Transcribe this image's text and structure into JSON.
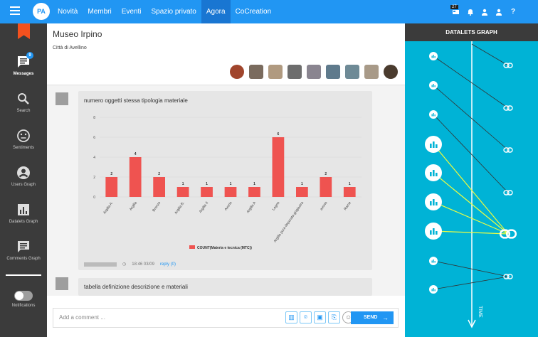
{
  "header": {
    "menu_icon": "menu-icon",
    "logo_text": "PA",
    "nav": [
      "Novità",
      "Membri",
      "Eventi",
      "Spazio privato",
      "Agora",
      "CoCreation"
    ],
    "active_nav": "Agora",
    "notif_count": "27",
    "icons": [
      "language-icon",
      "bell-icon",
      "person-icon",
      "person-icon",
      "help-icon"
    ]
  },
  "sidebar": {
    "items": [
      {
        "label": "Messages",
        "icon": "messages-icon",
        "badge": "9"
      },
      {
        "label": "Search",
        "icon": "search-icon"
      },
      {
        "label": "Sentiments",
        "icon": "sentiment-icon"
      },
      {
        "label": "Users Graph",
        "icon": "users-graph-icon"
      },
      {
        "label": "Datalets Graph",
        "icon": "datalets-graph-icon"
      },
      {
        "label": "Comments Graph",
        "icon": "comments-graph-icon"
      },
      {
        "label": "Notifications",
        "icon": "toggle-icon"
      }
    ]
  },
  "room": {
    "title": "Museo Irpino",
    "subtitle": "Città di Avellino"
  },
  "posts": [
    {
      "title": "numero oggetti stessa tipologia materiale",
      "time": "18:46 03/09",
      "reply": "reply (0)"
    },
    {
      "title": "tabella definizione descrizione e materiali"
    }
  ],
  "chart_data": {
    "type": "bar",
    "categories": [
      "Argilla A.",
      "Argilla",
      "Bronzo",
      "Argilla B.",
      "Argilla II",
      "Avorio",
      "Argilla A",
      "Legno",
      "Argilla pura depurata-grigiastra",
      "avorio",
      "Rame"
    ],
    "values": [
      2,
      4,
      2,
      1,
      1,
      1,
      1,
      6,
      1,
      2,
      1
    ],
    "ylim": [
      0,
      8
    ],
    "yticks": [
      0,
      2,
      4,
      6,
      8
    ],
    "legend": "COUNT(Materia e tecnica (MTC))",
    "color": "#ef5350"
  },
  "composer": {
    "placeholder": "Add a comment ...",
    "send_label": "SEND",
    "tools": [
      "chart-icon",
      "map-pin-icon",
      "image-icon",
      "attachment-icon",
      "emoji-icon"
    ]
  },
  "right_panel": {
    "title": "DATALETS GRAPH",
    "axis_label": "TIME"
  },
  "colors": {
    "primary": "#2196f3",
    "sidebar": "#3b3b3b",
    "panel": "#00b3d6",
    "bar": "#ef5350",
    "highlight_line": "#eeff41"
  }
}
